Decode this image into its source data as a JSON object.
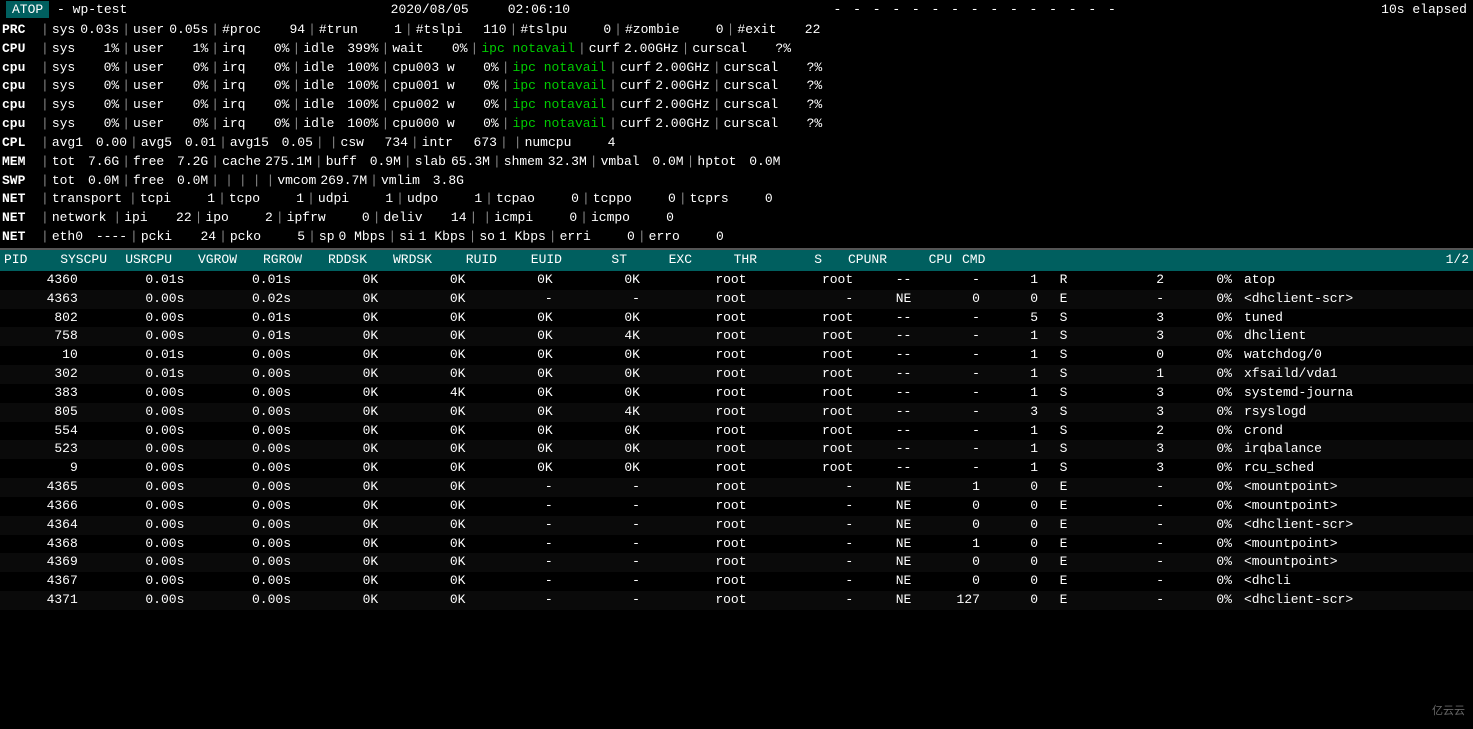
{
  "header": {
    "app_name": "ATOP",
    "hostname": "wp-test",
    "date": "2020/08/05",
    "time": "02:06:10",
    "separator": "- - - - - - - - - - - - - - -",
    "elapsed": "10s elapsed"
  },
  "sysrows": [
    {
      "label": "PRC",
      "fields": [
        {
          "k": "sys",
          "v": "0.03s"
        },
        {
          "k": "user",
          "v": "0.05s"
        },
        {
          "k": "#proc",
          "v": "94"
        },
        {
          "k": "#trun",
          "v": "1"
        },
        {
          "k": "#tslpi",
          "v": "110"
        },
        {
          "k": "#tslpu",
          "v": "0"
        },
        {
          "k": "#zombie",
          "v": "0"
        },
        {
          "k": "#exit",
          "v": "22"
        }
      ]
    },
    {
      "label": "CPU",
      "fields": [
        {
          "k": "sys",
          "v": "1%"
        },
        {
          "k": "user",
          "v": "1%"
        },
        {
          "k": "irq",
          "v": "0%"
        },
        {
          "k": "idle",
          "v": "399%"
        },
        {
          "k": "wait",
          "v": "0%"
        },
        {
          "k": "ipc notavail",
          "v": "",
          "green": true
        },
        {
          "k": "curf",
          "v": "2.00GHz"
        },
        {
          "k": "curscal",
          "v": "?%"
        }
      ]
    },
    {
      "label": "cpu",
      "fields": [
        {
          "k": "sys",
          "v": "0%"
        },
        {
          "k": "user",
          "v": "0%"
        },
        {
          "k": "irq",
          "v": "0%"
        },
        {
          "k": "idle",
          "v": "100%"
        },
        {
          "k": "cpu003 w",
          "v": "0%"
        },
        {
          "k": "ipc notavail",
          "v": "",
          "green": true
        },
        {
          "k": "curf",
          "v": "2.00GHz"
        },
        {
          "k": "curscal",
          "v": "?%"
        }
      ]
    },
    {
      "label": "cpu",
      "fields": [
        {
          "k": "sys",
          "v": "0%"
        },
        {
          "k": "user",
          "v": "0%"
        },
        {
          "k": "irq",
          "v": "0%"
        },
        {
          "k": "idle",
          "v": "100%"
        },
        {
          "k": "cpu001 w",
          "v": "0%"
        },
        {
          "k": "ipc notavail",
          "v": "",
          "green": true
        },
        {
          "k": "curf",
          "v": "2.00GHz"
        },
        {
          "k": "curscal",
          "v": "?%"
        }
      ]
    },
    {
      "label": "cpu",
      "fields": [
        {
          "k": "sys",
          "v": "0%"
        },
        {
          "k": "user",
          "v": "0%"
        },
        {
          "k": "irq",
          "v": "0%"
        },
        {
          "k": "idle",
          "v": "100%"
        },
        {
          "k": "cpu002 w",
          "v": "0%"
        },
        {
          "k": "ipc notavail",
          "v": "",
          "green": true
        },
        {
          "k": "curf",
          "v": "2.00GHz"
        },
        {
          "k": "curscal",
          "v": "?%"
        }
      ]
    },
    {
      "label": "cpu",
      "fields": [
        {
          "k": "sys",
          "v": "0%"
        },
        {
          "k": "user",
          "v": "0%"
        },
        {
          "k": "irq",
          "v": "0%"
        },
        {
          "k": "idle",
          "v": "100%"
        },
        {
          "k": "cpu000 w",
          "v": "0%"
        },
        {
          "k": "ipc notavail",
          "v": "",
          "green": true
        },
        {
          "k": "curf",
          "v": "2.00GHz"
        },
        {
          "k": "curscal",
          "v": "?%"
        }
      ]
    },
    {
      "label": "CPL",
      "fields": [
        {
          "k": "avg1",
          "v": "0.00"
        },
        {
          "k": "avg5",
          "v": "0.01"
        },
        {
          "k": "avg15",
          "v": "0.05"
        },
        {
          "k": "",
          "v": ""
        },
        {
          "k": "csw",
          "v": "734"
        },
        {
          "k": "intr",
          "v": "673"
        },
        {
          "k": "",
          "v": ""
        },
        {
          "k": "numcpu",
          "v": "4"
        }
      ]
    },
    {
      "label": "MEM",
      "fields": [
        {
          "k": "tot",
          "v": "7.6G"
        },
        {
          "k": "free",
          "v": "7.2G"
        },
        {
          "k": "cache",
          "v": "275.1M"
        },
        {
          "k": "buff",
          "v": "0.9M"
        },
        {
          "k": "slab",
          "v": "65.3M"
        },
        {
          "k": "shmem",
          "v": "32.3M"
        },
        {
          "k": "vmbal",
          "v": "0.0M"
        },
        {
          "k": "hptot",
          "v": "0.0M"
        }
      ]
    },
    {
      "label": "SWP",
      "fields": [
        {
          "k": "tot",
          "v": "0.0M"
        },
        {
          "k": "free",
          "v": "0.0M"
        },
        {
          "k": "",
          "v": ""
        },
        {
          "k": "",
          "v": ""
        },
        {
          "k": "",
          "v": ""
        },
        {
          "k": "",
          "v": ""
        },
        {
          "k": "vmcom",
          "v": "269.7M"
        },
        {
          "k": "vmlim",
          "v": "3.8G"
        }
      ]
    },
    {
      "label": "NET",
      "fields": [
        {
          "k": "transport",
          "v": ""
        },
        {
          "k": "tcpi",
          "v": "1"
        },
        {
          "k": "tcpo",
          "v": "1"
        },
        {
          "k": "udpi",
          "v": "1"
        },
        {
          "k": "udpo",
          "v": "1"
        },
        {
          "k": "tcpao",
          "v": "0"
        },
        {
          "k": "tcppo",
          "v": "0"
        },
        {
          "k": "tcprs",
          "v": "0"
        }
      ]
    },
    {
      "label": "NET",
      "fields": [
        {
          "k": "network",
          "v": ""
        },
        {
          "k": "ipi",
          "v": "22"
        },
        {
          "k": "ipo",
          "v": "2"
        },
        {
          "k": "ipfrw",
          "v": "0"
        },
        {
          "k": "deliv",
          "v": "14"
        },
        {
          "k": "",
          "v": ""
        },
        {
          "k": "icmpi",
          "v": "0"
        },
        {
          "k": "icmpo",
          "v": "0"
        }
      ]
    },
    {
      "label": "NET",
      "fields": [
        {
          "k": "eth0",
          "v": "----"
        },
        {
          "k": "pcki",
          "v": "24"
        },
        {
          "k": "pcko",
          "v": "5"
        },
        {
          "k": "sp",
          "v": "0 Mbps"
        },
        {
          "k": "si",
          "v": "1 Kbps"
        },
        {
          "k": "so",
          "v": "1 Kbps"
        },
        {
          "k": "erri",
          "v": "0"
        },
        {
          "k": "erro",
          "v": "0"
        }
      ]
    }
  ],
  "proc_header": {
    "columns": [
      "PID",
      "SYSCPU",
      "USRCPU",
      "VGROW",
      "RGROW",
      "RDDSK",
      "WRDSK",
      "RUID",
      "EUID",
      "ST",
      "EXC",
      "THR",
      "S",
      "CPUNR",
      "CPU",
      "CMD"
    ],
    "page": "1/2"
  },
  "processes": [
    {
      "pid": "4360",
      "syscpu": "0.01s",
      "usrcpu": "0.01s",
      "vgrow": "0K",
      "rgrow": "0K",
      "rddsk": "0K",
      "wrdsk": "0K",
      "ruid": "root",
      "euid": "root",
      "st": "--",
      "exc": "-",
      "thr": "1",
      "s": "R",
      "cpunr": "2",
      "cpu": "0%",
      "cmd": "atop"
    },
    {
      "pid": "4363",
      "syscpu": "0.00s",
      "usrcpu": "0.02s",
      "vgrow": "0K",
      "rgrow": "0K",
      "rddsk": "-",
      "wrdsk": "-",
      "ruid": "root",
      "euid": "-",
      "st": "NE",
      "exc": "0",
      "thr": "0",
      "s": "E",
      "cpunr": "-",
      "cpu": "0%",
      "cmd": "<dhclient-scr>"
    },
    {
      "pid": "802",
      "syscpu": "0.00s",
      "usrcpu": "0.01s",
      "vgrow": "0K",
      "rgrow": "0K",
      "rddsk": "0K",
      "wrdsk": "0K",
      "ruid": "root",
      "euid": "root",
      "st": "--",
      "exc": "-",
      "thr": "5",
      "s": "S",
      "cpunr": "3",
      "cpu": "0%",
      "cmd": "tuned"
    },
    {
      "pid": "758",
      "syscpu": "0.00s",
      "usrcpu": "0.01s",
      "vgrow": "0K",
      "rgrow": "0K",
      "rddsk": "0K",
      "wrdsk": "4K",
      "ruid": "root",
      "euid": "root",
      "st": "--",
      "exc": "-",
      "thr": "1",
      "s": "S",
      "cpunr": "3",
      "cpu": "0%",
      "cmd": "dhclient"
    },
    {
      "pid": "10",
      "syscpu": "0.01s",
      "usrcpu": "0.00s",
      "vgrow": "0K",
      "rgrow": "0K",
      "rddsk": "0K",
      "wrdsk": "0K",
      "ruid": "root",
      "euid": "root",
      "st": "--",
      "exc": "-",
      "thr": "1",
      "s": "S",
      "cpunr": "0",
      "cpu": "0%",
      "cmd": "watchdog/0"
    },
    {
      "pid": "302",
      "syscpu": "0.01s",
      "usrcpu": "0.00s",
      "vgrow": "0K",
      "rgrow": "0K",
      "rddsk": "0K",
      "wrdsk": "0K",
      "ruid": "root",
      "euid": "root",
      "st": "--",
      "exc": "-",
      "thr": "1",
      "s": "S",
      "cpunr": "1",
      "cpu": "0%",
      "cmd": "xfsaild/vda1"
    },
    {
      "pid": "383",
      "syscpu": "0.00s",
      "usrcpu": "0.00s",
      "vgrow": "0K",
      "rgrow": "4K",
      "rddsk": "0K",
      "wrdsk": "0K",
      "ruid": "root",
      "euid": "root",
      "st": "--",
      "exc": "-",
      "thr": "1",
      "s": "S",
      "cpunr": "3",
      "cpu": "0%",
      "cmd": "systemd-journa"
    },
    {
      "pid": "805",
      "syscpu": "0.00s",
      "usrcpu": "0.00s",
      "vgrow": "0K",
      "rgrow": "0K",
      "rddsk": "0K",
      "wrdsk": "4K",
      "ruid": "root",
      "euid": "root",
      "st": "--",
      "exc": "-",
      "thr": "3",
      "s": "S",
      "cpunr": "3",
      "cpu": "0%",
      "cmd": "rsyslogd"
    },
    {
      "pid": "554",
      "syscpu": "0.00s",
      "usrcpu": "0.00s",
      "vgrow": "0K",
      "rgrow": "0K",
      "rddsk": "0K",
      "wrdsk": "0K",
      "ruid": "root",
      "euid": "root",
      "st": "--",
      "exc": "-",
      "thr": "1",
      "s": "S",
      "cpunr": "2",
      "cpu": "0%",
      "cmd": "crond"
    },
    {
      "pid": "523",
      "syscpu": "0.00s",
      "usrcpu": "0.00s",
      "vgrow": "0K",
      "rgrow": "0K",
      "rddsk": "0K",
      "wrdsk": "0K",
      "ruid": "root",
      "euid": "root",
      "st": "--",
      "exc": "-",
      "thr": "1",
      "s": "S",
      "cpunr": "3",
      "cpu": "0%",
      "cmd": "irqbalance"
    },
    {
      "pid": "9",
      "syscpu": "0.00s",
      "usrcpu": "0.00s",
      "vgrow": "0K",
      "rgrow": "0K",
      "rddsk": "0K",
      "wrdsk": "0K",
      "ruid": "root",
      "euid": "root",
      "st": "--",
      "exc": "-",
      "thr": "1",
      "s": "S",
      "cpunr": "3",
      "cpu": "0%",
      "cmd": "rcu_sched"
    },
    {
      "pid": "4365",
      "syscpu": "0.00s",
      "usrcpu": "0.00s",
      "vgrow": "0K",
      "rgrow": "0K",
      "rddsk": "-",
      "wrdsk": "-",
      "ruid": "root",
      "euid": "-",
      "st": "NE",
      "exc": "1",
      "thr": "0",
      "s": "E",
      "cpunr": "-",
      "cpu": "0%",
      "cmd": "<mountpoint>"
    },
    {
      "pid": "4366",
      "syscpu": "0.00s",
      "usrcpu": "0.00s",
      "vgrow": "0K",
      "rgrow": "0K",
      "rddsk": "-",
      "wrdsk": "-",
      "ruid": "root",
      "euid": "-",
      "st": "NE",
      "exc": "0",
      "thr": "0",
      "s": "E",
      "cpunr": "-",
      "cpu": "0%",
      "cmd": "<mountpoint>"
    },
    {
      "pid": "4364",
      "syscpu": "0.00s",
      "usrcpu": "0.00s",
      "vgrow": "0K",
      "rgrow": "0K",
      "rddsk": "-",
      "wrdsk": "-",
      "ruid": "root",
      "euid": "-",
      "st": "NE",
      "exc": "0",
      "thr": "0",
      "s": "E",
      "cpunr": "-",
      "cpu": "0%",
      "cmd": "<dhclient-scr>"
    },
    {
      "pid": "4368",
      "syscpu": "0.00s",
      "usrcpu": "0.00s",
      "vgrow": "0K",
      "rgrow": "0K",
      "rddsk": "-",
      "wrdsk": "-",
      "ruid": "root",
      "euid": "-",
      "st": "NE",
      "exc": "1",
      "thr": "0",
      "s": "E",
      "cpunr": "-",
      "cpu": "0%",
      "cmd": "<mountpoint>"
    },
    {
      "pid": "4369",
      "syscpu": "0.00s",
      "usrcpu": "0.00s",
      "vgrow": "0K",
      "rgrow": "0K",
      "rddsk": "-",
      "wrdsk": "-",
      "ruid": "root",
      "euid": "-",
      "st": "NE",
      "exc": "0",
      "thr": "0",
      "s": "E",
      "cpunr": "-",
      "cpu": "0%",
      "cmd": "<mountpoint>"
    },
    {
      "pid": "4367",
      "syscpu": "0.00s",
      "usrcpu": "0.00s",
      "vgrow": "0K",
      "rgrow": "0K",
      "rddsk": "-",
      "wrdsk": "-",
      "ruid": "root",
      "euid": "-",
      "st": "NE",
      "exc": "0",
      "thr": "0",
      "s": "E",
      "cpunr": "-",
      "cpu": "0%",
      "cmd": "<dhcli"
    },
    {
      "pid": "4371",
      "syscpu": "0.00s",
      "usrcpu": "0.00s",
      "vgrow": "0K",
      "rgrow": "0K",
      "rddsk": "-",
      "wrdsk": "-",
      "ruid": "root",
      "euid": "-",
      "st": "NE",
      "exc": "127",
      "thr": "0",
      "s": "E",
      "cpunr": "-",
      "cpu": "0%",
      "cmd": "<dhclient-scr>"
    }
  ],
  "watermark": "亿云云"
}
